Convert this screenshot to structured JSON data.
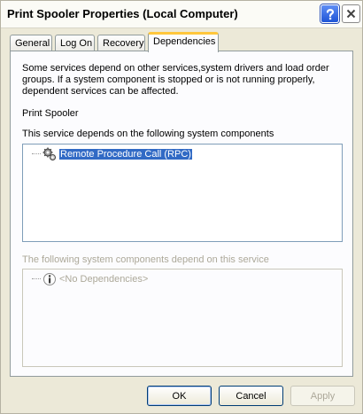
{
  "window": {
    "title": "Print Spooler Properties (Local Computer)",
    "help_button": "?",
    "close_button": "X"
  },
  "tabs": [
    {
      "label": "General",
      "active": false
    },
    {
      "label": "Log On",
      "active": false
    },
    {
      "label": "Recovery",
      "active": false
    },
    {
      "label": "Dependencies",
      "active": true
    }
  ],
  "dependencies": {
    "description": "Some services depend on other services,system drivers and load order groups. If a system component is stopped or is not running properly, dependent services can be affected.",
    "service_name": "Print Spooler",
    "depends_on_label": "This service depends on the following system components",
    "depends_on_items": [
      {
        "label": "Remote Procedure Call (RPC)",
        "icon": "gears-icon",
        "selected": true
      }
    ],
    "dependents_label": "The following system components depend on this service",
    "dependents_items": [
      {
        "label": "<No Dependencies>",
        "icon": "info-icon",
        "disabled": true
      }
    ]
  },
  "buttons": {
    "ok": "OK",
    "cancel": "Cancel",
    "apply": "Apply"
  },
  "colors": {
    "selection": "#316ac5",
    "tab_highlight": "#ffc73c",
    "disabled_text": "#aca899"
  }
}
